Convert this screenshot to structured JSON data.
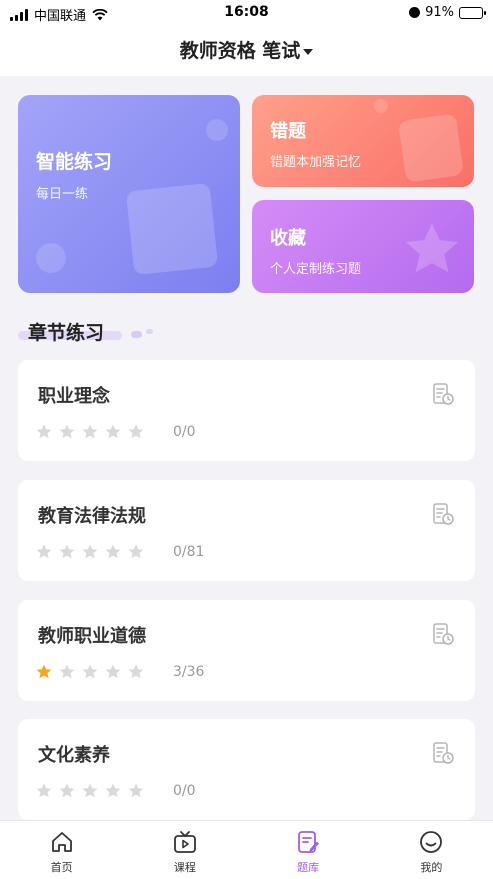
{
  "status_bar": {
    "carrier": "中国联通",
    "time": "16:08",
    "battery": "91%",
    "battery_level": 0.91
  },
  "header": {
    "title": "教师资格 笔试"
  },
  "cards": {
    "smart": {
      "title": "智能练习",
      "subtitle": "每日一练"
    },
    "wrong": {
      "title": "错题",
      "subtitle": "错题本加强记忆"
    },
    "favorite": {
      "title": "收藏",
      "subtitle": "个人定制练习题"
    }
  },
  "section": {
    "title": "章节练习"
  },
  "chapters": [
    {
      "name": "职业理念",
      "progress": "0/0",
      "stars": 0
    },
    {
      "name": "教育法律法规",
      "progress": "0/81",
      "stars": 0
    },
    {
      "name": "教师职业道德",
      "progress": "3/36",
      "stars": 1
    },
    {
      "name": "文化素养",
      "progress": "0/0",
      "stars": 0
    }
  ],
  "tabs": [
    {
      "label": "首页",
      "icon": "home-icon",
      "active": false
    },
    {
      "label": "课程",
      "icon": "tv-play-icon",
      "active": false
    },
    {
      "label": "题库",
      "icon": "edit-note-icon",
      "active": true
    },
    {
      "label": "我的",
      "icon": "smile-icon",
      "active": false
    }
  ],
  "colors": {
    "accent": "#a45bea",
    "star_filled": "#f5a623",
    "star_empty": "#d9d9d9"
  }
}
